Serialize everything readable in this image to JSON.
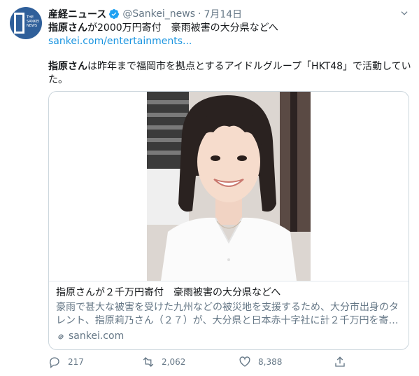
{
  "account": {
    "name": "産経ニュース",
    "handle": "@Sankei_news",
    "separator": "·",
    "date": "7月14日",
    "avatar_text": "THE SANKEI NEWS"
  },
  "tweet": {
    "line1_bold": "指原さん",
    "line1_rest": "が2000万円寄付　豪雨被害の大分県などへ",
    "link": "sankei.com/entertainments...",
    "line2_bold": "指原さん",
    "line2_rest": "は昨年まで福岡市を拠点とするアイドルグループ「HKT48」で活動していた。"
  },
  "card": {
    "title": "指原さんが２千万円寄付　豪雨被害の大分県などへ",
    "description": "豪雨で甚大な被害を受けた九州などの被災地を支援するため、大分市出身のタレント、指原莉乃さん（２７）が、大分県と日本赤十字社に計２千万円を寄…",
    "domain": "sankei.com"
  },
  "actions": {
    "reply_count": "217",
    "retweet_count": "2,062",
    "like_count": "8,388"
  },
  "colors": {
    "link": "#1b95e0",
    "muted": "#657786",
    "verified": "#1da1f2",
    "avatar": "#2f5f9a"
  }
}
